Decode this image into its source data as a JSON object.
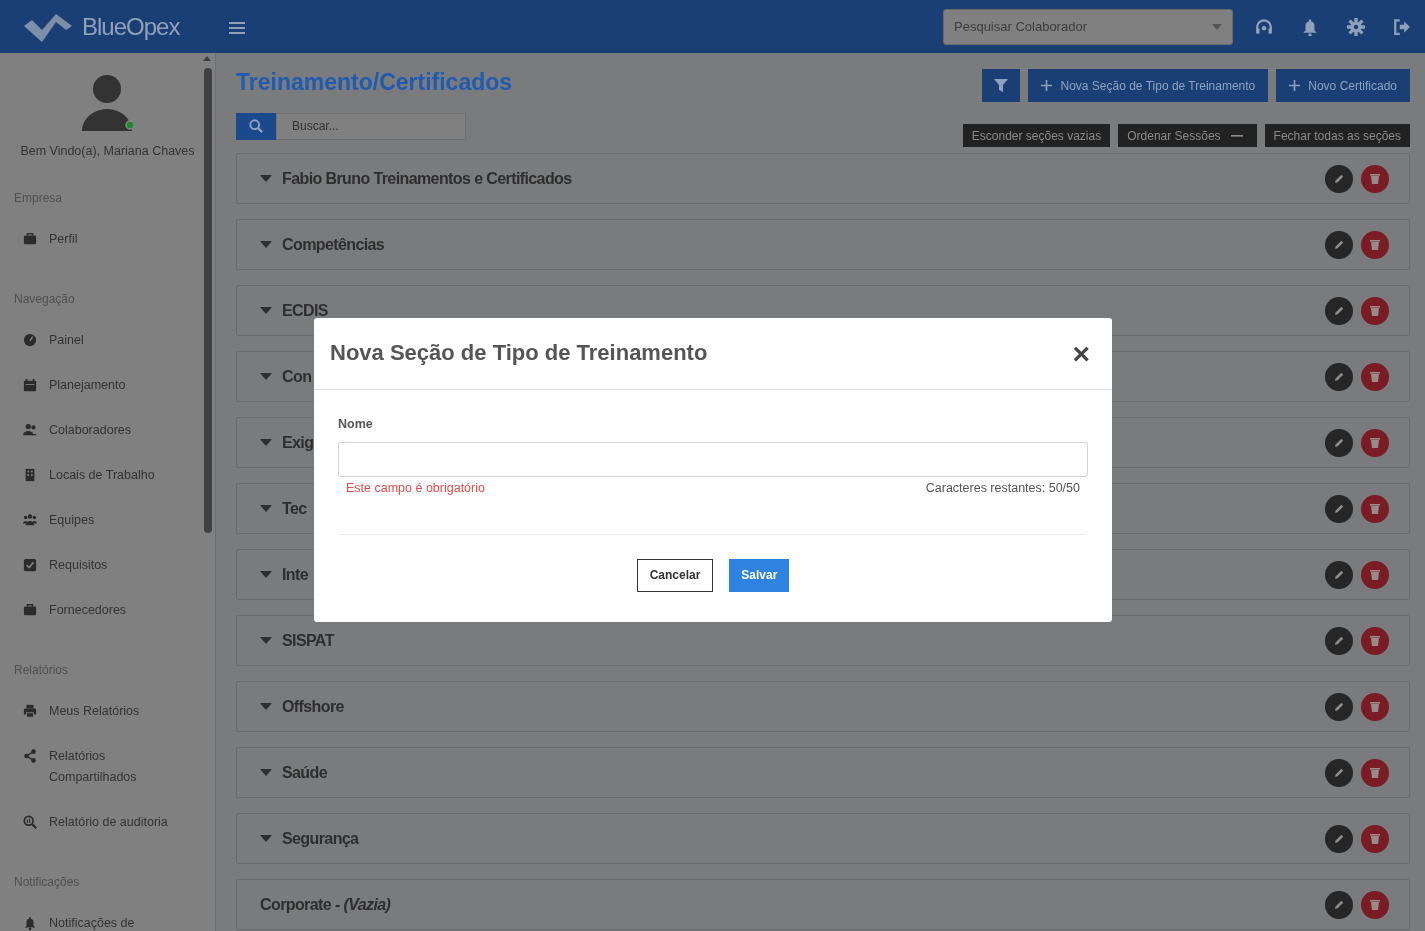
{
  "topbar": {
    "logo": "BlueOpex",
    "search": {
      "placeholder": "Pesquisar Colaborador"
    },
    "icons": [
      {
        "kind": "headset"
      },
      {
        "kind": "bell"
      },
      {
        "kind": "gear"
      },
      {
        "kind": "logout"
      }
    ]
  },
  "sidebar": {
    "greeting": "Bem Vindo(a), Mariana Chaves",
    "online": true,
    "groups": [
      {
        "title": "Empresa",
        "items": [
          {
            "label": "Perfil",
            "kind": "briefcase"
          }
        ]
      },
      {
        "title": "Navegação",
        "items": [
          {
            "label": "Painel",
            "kind": "gauge"
          },
          {
            "label": "Planejamento",
            "kind": "calendar"
          },
          {
            "label": "Colaboradores",
            "kind": "users"
          },
          {
            "label": "Locais de Trabalho",
            "kind": "building"
          },
          {
            "label": "Equipes",
            "kind": "team"
          },
          {
            "label": "Requisitos",
            "kind": "check"
          },
          {
            "label": "Fornecedores",
            "kind": "briefcase"
          }
        ]
      },
      {
        "title": "Relatórios",
        "items": [
          {
            "label": "Meus Relatórios",
            "kind": "printer"
          },
          {
            "label": "Relatórios Compartilhados",
            "kind": "share"
          },
          {
            "label": "Relatório de auditoria",
            "kind": "audit"
          }
        ]
      },
      {
        "title": "Notificações",
        "items": [
          {
            "label": "Notificações de",
            "kind": "bell"
          }
        ]
      }
    ]
  },
  "page": {
    "title": "Treinamento/Certificados",
    "search": {
      "placeholder": "Buscar..."
    },
    "actions": [
      {
        "kind": "filter"
      },
      {
        "kind": "add",
        "label": "Nova Seção de Tipo de Treinamento"
      },
      {
        "kind": "add",
        "label": "Novo Certificado"
      }
    ],
    "toggles": [
      {
        "label": "Esconder seções vazias",
        "minus": false
      },
      {
        "label": "Ordenar Sessões",
        "minus": true
      },
      {
        "label": "Fechar todas as seções",
        "minus": false
      }
    ],
    "sections": [
      {
        "title": "Fabio Bruno Treinamentos e Certificados",
        "expanded": true
      },
      {
        "title": "Competências",
        "expanded": true
      },
      {
        "title": "ECDIS",
        "expanded": true
      },
      {
        "title": "Con",
        "expanded": true
      },
      {
        "title": "Exig",
        "expanded": true
      },
      {
        "title": "Tec",
        "expanded": true
      },
      {
        "title": "Inte",
        "expanded": true
      },
      {
        "title": "SISPAT",
        "expanded": true
      },
      {
        "title": "Offshore",
        "expanded": true
      },
      {
        "title": "Saúde",
        "expanded": true
      },
      {
        "title": "Segurança",
        "expanded": true
      },
      {
        "title": "Corporate - *(Vazia)*",
        "expanded": false
      }
    ]
  },
  "modal": {
    "title": "Nova Seção de Tipo de Treinamento",
    "close": "×",
    "field_label": "Nome",
    "error": "Este campo é obrigatório",
    "counter": "Caracteres restantes: 50/50",
    "buttons": [
      {
        "label": "Cancelar",
        "kind": "secondary"
      },
      {
        "label": "Salvar",
        "kind": "primary"
      }
    ]
  }
}
